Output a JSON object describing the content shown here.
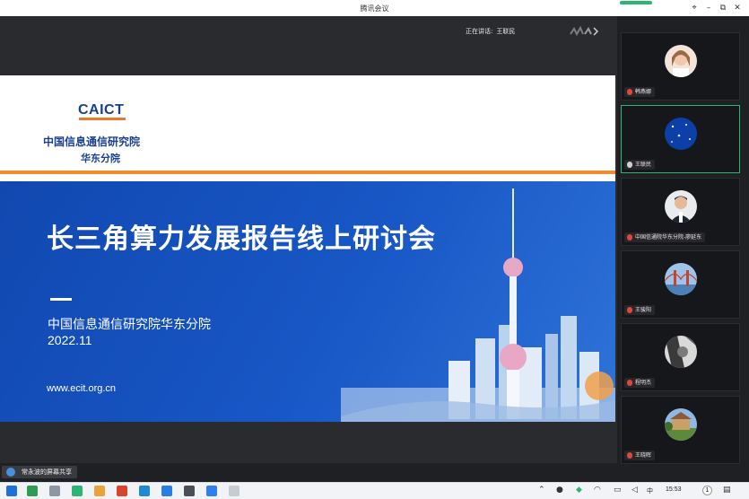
{
  "window": {
    "title": "腾讯会议",
    "controls": {
      "minimize": "–",
      "maximize": "⧉",
      "close": "✕"
    }
  },
  "stage": {
    "speaking_label": "正在讲话:",
    "speaking_name": "王联民"
  },
  "slide": {
    "logo_text": "CAICT",
    "org_name": "中国信息通信研究院",
    "org_branch": "华东分院",
    "headline": "长三角算力发展报告线上研讨会",
    "subtitle": "中国信息通信研究院华东分院",
    "date": "2022.11",
    "url": "www.ecit.org.cn"
  },
  "share_badge": "常永波的屏幕共享",
  "participants": [
    {
      "name": "韩燕娜",
      "muted": true,
      "avatar": "woman-photo",
      "active": false
    },
    {
      "name": "王联民",
      "muted": false,
      "avatar": "starry-sky",
      "active": true
    },
    {
      "name": "中国信通院华东分院-廖延东",
      "muted": true,
      "avatar": "man-suit",
      "active": false
    },
    {
      "name": "王骏阳",
      "muted": true,
      "avatar": "bridge",
      "active": false
    },
    {
      "name": "程明杰",
      "muted": true,
      "avatar": "bw-portrait",
      "active": false
    },
    {
      "name": "王晓晖",
      "muted": true,
      "avatar": "landscape",
      "active": false
    }
  ],
  "taskbar": {
    "ime": "中",
    "time": "15:53",
    "notification_count": "1",
    "colors": {
      "start": "#1e6fd9",
      "accent": "#2bb673"
    }
  }
}
